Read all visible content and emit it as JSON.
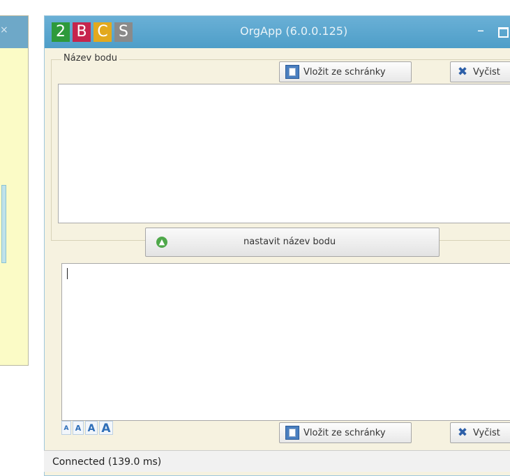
{
  "background_window": {
    "close_glyph": "×"
  },
  "titlebar": {
    "logo_letters": [
      "2",
      "B",
      "C",
      "S"
    ],
    "logo_colors": [
      "#2e9a3b",
      "#c6244d",
      "#e2a91e",
      "#8a8a8a"
    ],
    "title": "OrgApp (6.0.0.125)",
    "minimize_glyph": "–"
  },
  "point_name_group": {
    "label": "Název bodu",
    "paste_button": {
      "label": "Vložit ze schránky",
      "icon": "clipboard-icon"
    },
    "clear_button": {
      "label": "Vyčist",
      "icon": "clear-x-icon"
    },
    "text_value": ""
  },
  "set_name_button": {
    "label": "nastavit název bodu",
    "icon": "arrow-up-circle-icon"
  },
  "editor": {
    "text_value": "",
    "font_size_buttons": [
      "A",
      "A",
      "A",
      "A"
    ],
    "paste_button": {
      "label": "Vložit ze schránky",
      "icon": "clipboard-icon"
    },
    "clear_button": {
      "label": "Vyčist",
      "icon": "clear-x-icon"
    }
  },
  "status_bar": {
    "text": "Connected (139.0 ms)"
  },
  "colors": {
    "titlebar": "#5aa8d0",
    "window_bg": "#f6f2e0",
    "bg_window": "#fbfbc6"
  }
}
